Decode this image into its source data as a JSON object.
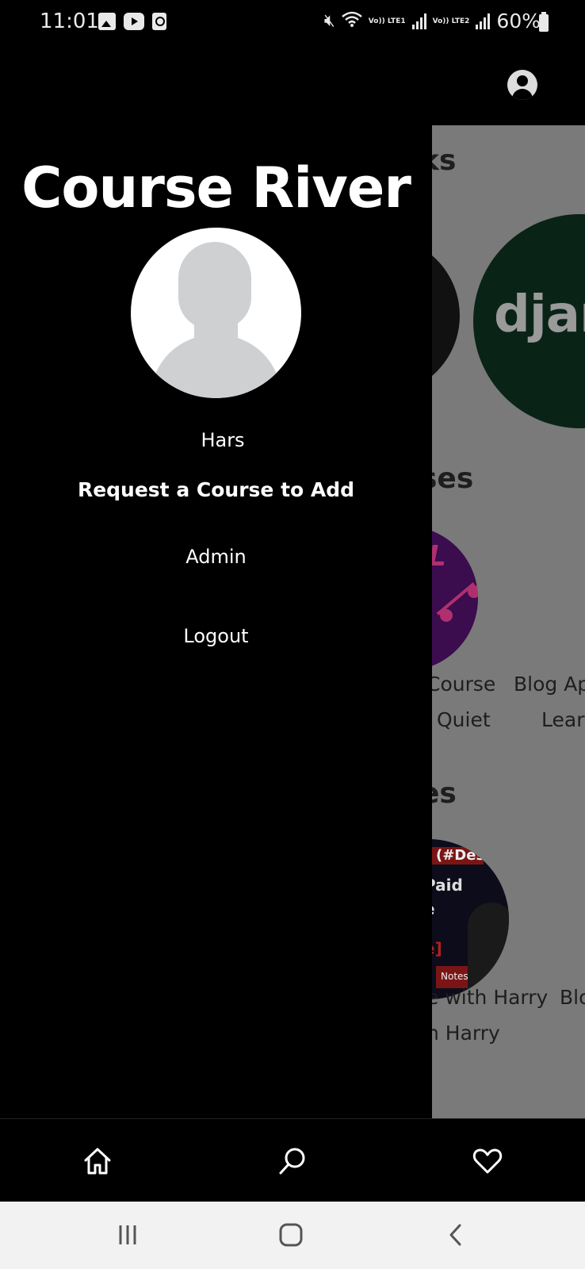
{
  "status_bar": {
    "time": "11:01",
    "lte1": "Vo)) LTE1",
    "lte2": "Vo)) LTE2",
    "battery": "60%"
  },
  "drawer": {
    "title": "Course River",
    "username": "Hars",
    "items": [
      {
        "label": "Request a Course to Add"
      },
      {
        "label": "Admin"
      },
      {
        "label": "Logout"
      }
    ]
  },
  "background": {
    "section1_partial": "ks",
    "section2_partial": "ses",
    "section3_partial": "es",
    "django_partial": "djar",
    "card_text": [
      "Course",
      "Blog Ap",
      "Quiet",
      "Lear",
      "e with Harry",
      "Blo",
      "h Harry"
    ],
    "thumb_text": [
      "(#Des",
      "Paid",
      "e",
      "e]",
      "Notes"
    ]
  },
  "bottom_nav": {
    "icons": [
      "home-icon",
      "search-icon",
      "heart-icon"
    ]
  },
  "colors": {
    "drawer_bg": "#000000",
    "scrim": "#7a7a7a",
    "text": "#ffffff"
  }
}
